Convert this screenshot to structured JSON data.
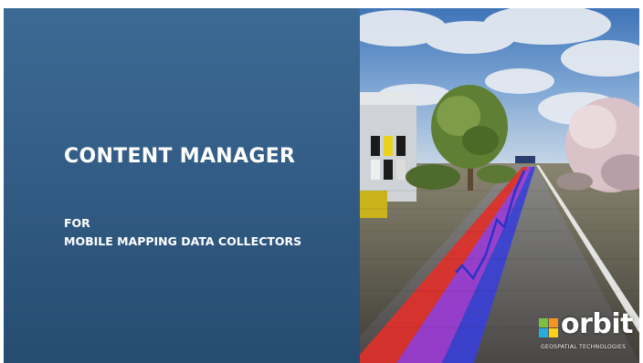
{
  "slide": {
    "title": "CONTENT MANAGER",
    "subtitle_line1": "FOR",
    "subtitle_line2": "MOBILE MAPPING DATA COLLECTORS"
  },
  "photo": {
    "icon": "point-cloud-street-image"
  },
  "logo": {
    "name": "orbit",
    "tagline": "GEOSPATIAL TECHNOLOGIES"
  },
  "colors": {
    "panel_top": "#3c6a94",
    "panel_bottom": "#264c70",
    "accent_red": "#e0302a",
    "accent_blue": "#3a3fd8",
    "logo_green": "#7ac143",
    "logo_orange": "#f7941d",
    "logo_blue": "#29abe2",
    "logo_yellow": "#fcd116"
  }
}
